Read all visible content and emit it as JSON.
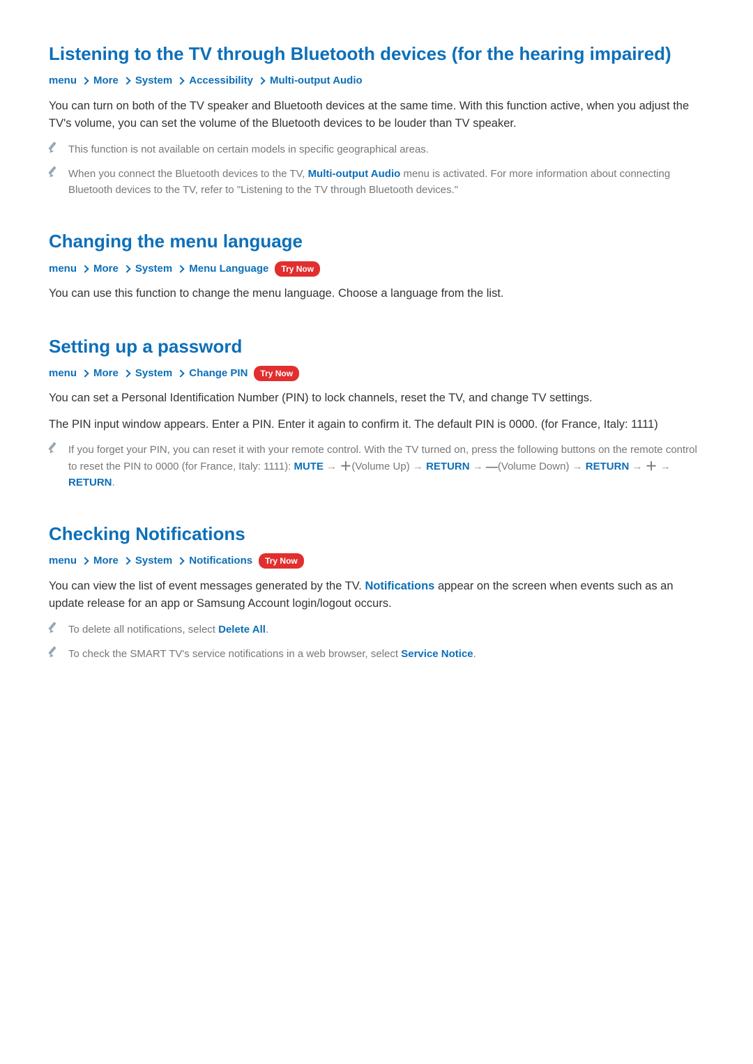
{
  "common": {
    "tryNow": "Try Now",
    "crumbs": {
      "menu": "menu",
      "more": "More",
      "system": "System",
      "accessibility": "Accessibility",
      "menuLanguage": "Menu Language",
      "changePin": "Change PIN",
      "notifications": "Notifications",
      "multiOutput": "Multi-output Audio"
    }
  },
  "s1": {
    "title": "Listening to the TV through Bluetooth devices (for the hearing impaired)",
    "body": "You can turn on both of the TV speaker and Bluetooth devices at the same time. With this function active, when you adjust the TV's volume, you can set the volume of the Bluetooth devices to be louder than TV speaker.",
    "note1": "This function is not available on certain models in specific geographical areas.",
    "note2a": "When you connect the Bluetooth devices to the TV, ",
    "note2kw": "Multi-output Audio",
    "note2b": " menu is activated. For more information about connecting Bluetooth devices to the TV, refer to \"Listening to the TV through Bluetooth devices.\""
  },
  "s2": {
    "title": "Changing the menu language",
    "body": "You can use this function to change the menu language. Choose a language from the list."
  },
  "s3": {
    "title": "Setting up a password",
    "body1": "You can set a Personal Identification Number (PIN) to lock channels, reset the TV, and change TV settings.",
    "body2": "The PIN input window appears. Enter a PIN. Enter it again to confirm it. The default PIN is 0000. (for France, Italy: 1111)",
    "note1a": "If you forget your PIN, you can reset it with your remote control. With the TV turned on, press the following buttons on the remote control to reset the PIN to 0000 (for France, Italy: 1111): ",
    "mute": "MUTE",
    "volUp": "(Volume Up)",
    "return": "RETURN",
    "volDown": "(Volume Down)",
    "period": "."
  },
  "s4": {
    "title": "Checking Notifications",
    "body1a": "You can view the list of event messages generated by the TV. ",
    "body1kw": "Notifications",
    "body1b": " appear on the screen when events such as an update release for an app or Samsung Account login/logout occurs.",
    "note1a": "To delete all notifications, select ",
    "note1kw": "Delete All",
    "note1b": ".",
    "note2a": "To check the SMART TV's service notifications in a web browser, select ",
    "note2kw": "Service Notice",
    "note2b": "."
  }
}
